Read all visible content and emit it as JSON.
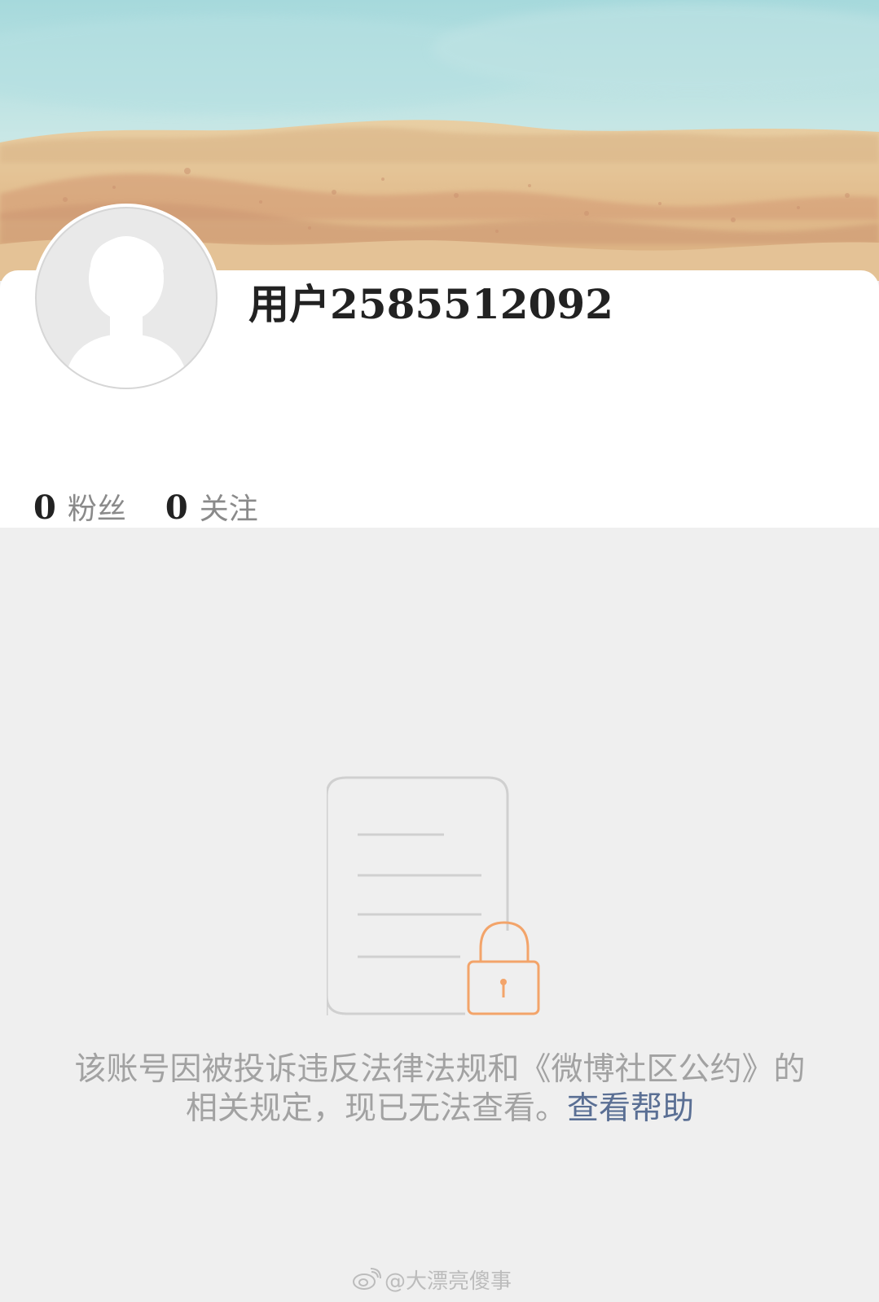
{
  "profile": {
    "username": "用户2585512092",
    "avatar_icon": "default-avatar-silhouette",
    "stats": [
      {
        "count": "0",
        "label": "粉丝"
      },
      {
        "count": "0",
        "label": "关注"
      }
    ]
  },
  "cover": {
    "image": "beach-sand-sky-banner"
  },
  "locked": {
    "icon": "document-lock-icon",
    "message": "该账号因被投诉违反法律法规和《微博社区公约》的相关规定，现已无法查看。",
    "help_link": "查看帮助"
  },
  "watermark": {
    "icon": "weibo-logo-icon",
    "handle": "@大漂亮傻事"
  },
  "colors": {
    "lock_accent": "#f3a46a",
    "link": "#5a6f94",
    "page_bg": "#efefef",
    "card_bg": "#ffffff"
  }
}
